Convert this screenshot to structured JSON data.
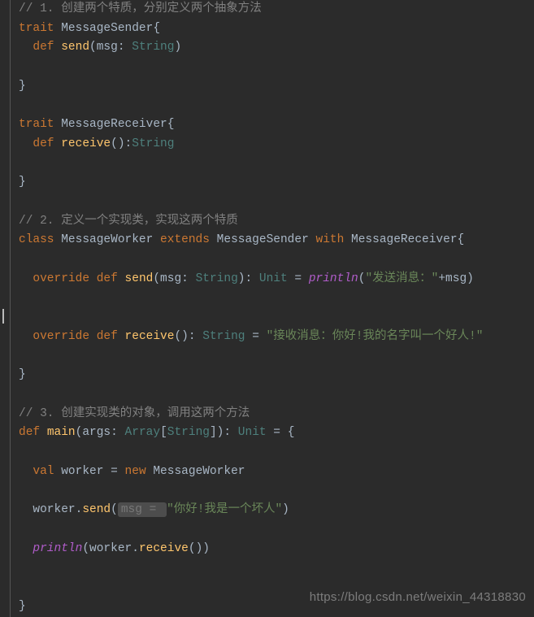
{
  "code": {
    "c1": "// 1. 创建两个特质，分别定义两个抽象方法",
    "kw_trait1": "trait",
    "trait1_name": "MessageSender",
    "brace_open": "{",
    "kw_def1": "def",
    "m_send": "send",
    "send_params": "(msg: ",
    "type_string": "String",
    "paren_close": ")",
    "brace_close": "}",
    "kw_trait2": "trait",
    "trait2_name": "MessageReceiver",
    "kw_def2": "def",
    "m_receive": "receive",
    "recv_sig": "():",
    "c2": "// 2. 定义一个实现类，实现这两个特质",
    "kw_class": "class",
    "worker_name": "MessageWorker",
    "kw_extends": "extends",
    "kw_with": "with",
    "kw_override1": "override",
    "kw_def3": "def",
    "send2_sig_open": "(msg: ",
    "send2_sig_close": "): ",
    "type_unit": "Unit",
    "eq": " = ",
    "fn_println": "println",
    "str_send_msg": "\"发送消息：\"",
    "plus_msg": "+msg)",
    "kw_override2": "override",
    "kw_def4": "def",
    "recv2_sig": "(): ",
    "str_recv": "\"接收消息：你好!我的名字叫一个好人!\"",
    "c3": "// 3. 创建实现类的对象，调用这两个方法",
    "kw_def5": "def",
    "m_main": "main",
    "main_sig_open": "(args: ",
    "type_array": "Array",
    "arr_open": "[",
    "arr_close": "]): ",
    "kw_val": "val",
    "var_worker": "worker",
    "kw_new": "new",
    "dot": ".",
    "send_call_open": "(",
    "hint_badge": "msg = ",
    "str_arg": "\"你好!我是一个坏人\"",
    "call_close": ")",
    "recv_call": "())",
    "paren_open": "("
  },
  "watermark": "https://blog.csdn.net/weixin_44318830"
}
